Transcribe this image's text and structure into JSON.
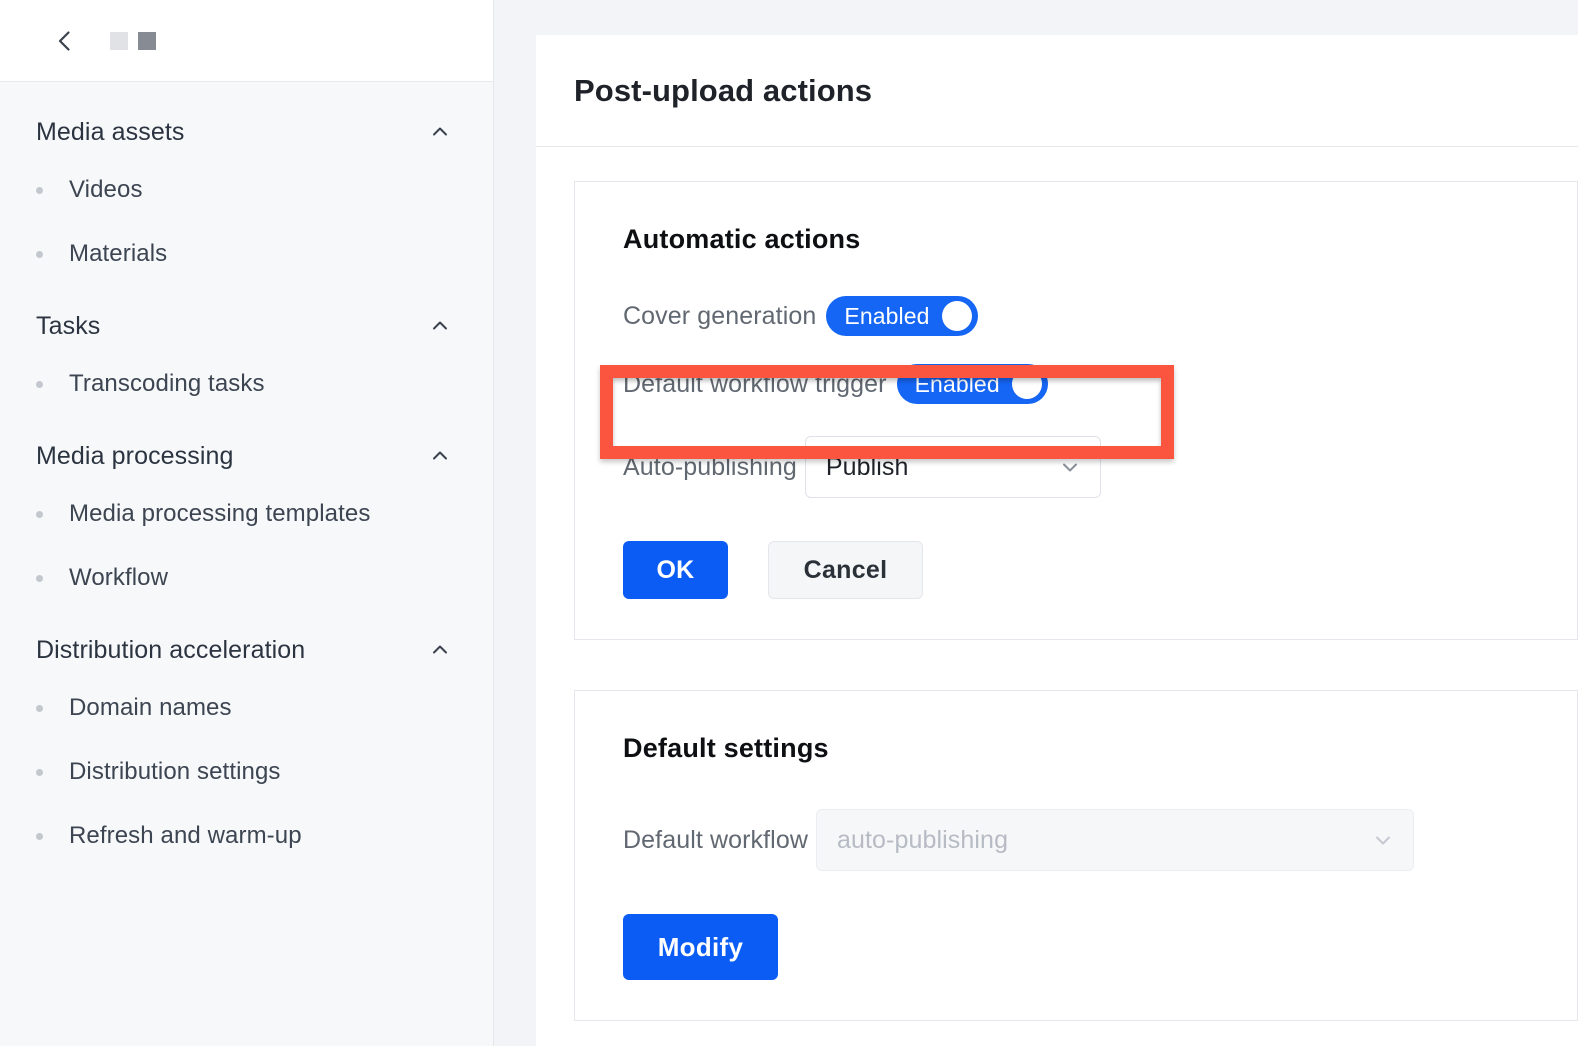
{
  "sidebar": {
    "back_icon": "chevron-left-icon",
    "brand_block_light": "placeholder-block-light",
    "brand_block_dark": "placeholder-block-dark",
    "groups": [
      {
        "title": "Media assets",
        "caret": "chevron-up-icon",
        "items": [
          {
            "label": "Videos"
          },
          {
            "label": "Materials"
          }
        ]
      },
      {
        "title": "Tasks",
        "caret": "chevron-up-icon",
        "items": [
          {
            "label": "Transcoding tasks"
          }
        ]
      },
      {
        "title": "Media processing",
        "caret": "chevron-up-icon",
        "items": [
          {
            "label": "Media processing templates"
          },
          {
            "label": "Workflow"
          }
        ]
      },
      {
        "title": "Distribution acceleration",
        "caret": "chevron-up-icon",
        "items": [
          {
            "label": "Domain names"
          },
          {
            "label": "Distribution settings"
          },
          {
            "label": "Refresh and warm-up"
          }
        ]
      }
    ]
  },
  "main": {
    "page_title": "Post-upload actions",
    "automatic_actions": {
      "title": "Automatic actions",
      "cover_generation": {
        "label": "Cover generation",
        "toggle_text": "Enabled",
        "state": "on"
      },
      "default_workflow_trigger": {
        "label": "Default workflow trigger",
        "toggle_text": "Enabled",
        "state": "on"
      },
      "auto_publishing": {
        "label": "Auto-publishing",
        "value": "Publish",
        "chevron": "chevron-down-icon"
      },
      "ok_label": "OK",
      "cancel_label": "Cancel"
    },
    "default_settings": {
      "title": "Default settings",
      "default_workflow": {
        "label": "Default workflow",
        "placeholder": "auto-publishing",
        "value": "auto-publishing",
        "disabled": true,
        "chevron": "chevron-down-icon"
      },
      "modify_label": "Modify"
    }
  },
  "annotation": {
    "target": "Default workflow trigger",
    "color": "#fb5540"
  }
}
